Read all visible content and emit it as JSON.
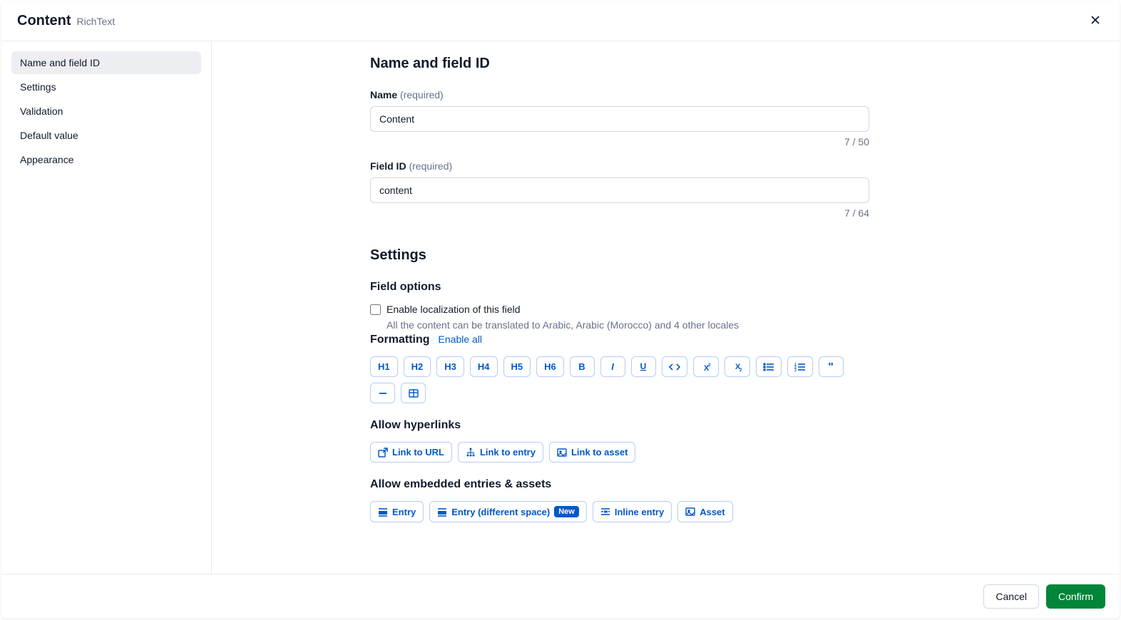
{
  "header": {
    "title": "Content",
    "subtitle": "RichText"
  },
  "sidebar": {
    "items": [
      {
        "label": "Name and field ID"
      },
      {
        "label": "Settings"
      },
      {
        "label": "Validation"
      },
      {
        "label": "Default value"
      },
      {
        "label": "Appearance"
      }
    ]
  },
  "main": {
    "section1_heading": "Name and field ID",
    "name_label": "Name",
    "name_req": "(required)",
    "name_value": "Content",
    "name_counter": "7 / 50",
    "fieldid_label": "Field ID",
    "fieldid_req": "(required)",
    "fieldid_value": "content",
    "fieldid_counter": "7 / 64",
    "section2_heading": "Settings",
    "field_options_heading": "Field options",
    "localization_label": "Enable localization of this field",
    "localization_help": "All the content can be translated to Arabic, Arabic (Morocco) and 4 other locales",
    "formatting_heading": "Formatting",
    "enable_all": "Enable all",
    "format_h1": "H1",
    "format_h2": "H2",
    "format_h3": "H3",
    "format_h4": "H4",
    "format_h5": "H5",
    "format_h6": "H6",
    "allow_hyperlinks_heading": "Allow hyperlinks",
    "link_url": "Link to URL",
    "link_entry": "Link to entry",
    "link_asset": "Link to asset",
    "allow_embedded_heading": "Allow embedded entries & assets",
    "embed_entry": "Entry",
    "embed_entry_diff": "Entry (different space)",
    "embed_new_badge": "New",
    "embed_inline": "Inline entry",
    "embed_asset": "Asset"
  },
  "footer": {
    "cancel": "Cancel",
    "confirm": "Confirm"
  }
}
